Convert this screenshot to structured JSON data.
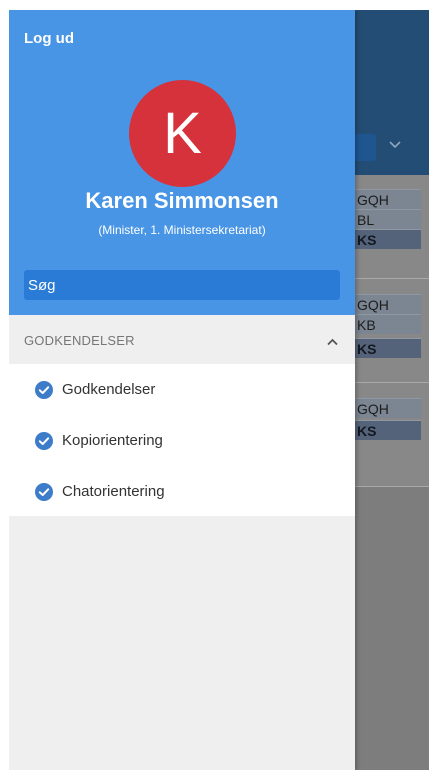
{
  "drawer": {
    "logout_label": "Log ud",
    "avatar_initial": "K",
    "user_name": "Karen Simmonsen",
    "user_role": "(Minister, 1. Ministersekretariat)",
    "search_placeholder": "Søg"
  },
  "section": {
    "title": "GODKENDELSER",
    "expanded": true,
    "items": [
      {
        "label": "Godkendelser",
        "icon": "check-circle-icon"
      },
      {
        "label": "Kopiorientering",
        "icon": "check-circle-icon"
      },
      {
        "label": "Chatorientering",
        "icon": "check-circle-icon"
      }
    ]
  },
  "background": {
    "group1": [
      "GQH",
      "BL",
      "KS"
    ],
    "group2": [
      "GQH",
      "KB",
      "KS"
    ],
    "group3": [
      "GQH",
      "KS"
    ]
  },
  "colors": {
    "drawer_header": "#4895e6",
    "avatar": "#d6323b",
    "search_field": "#2a7bd6",
    "check_icon": "#3d7cc9"
  }
}
